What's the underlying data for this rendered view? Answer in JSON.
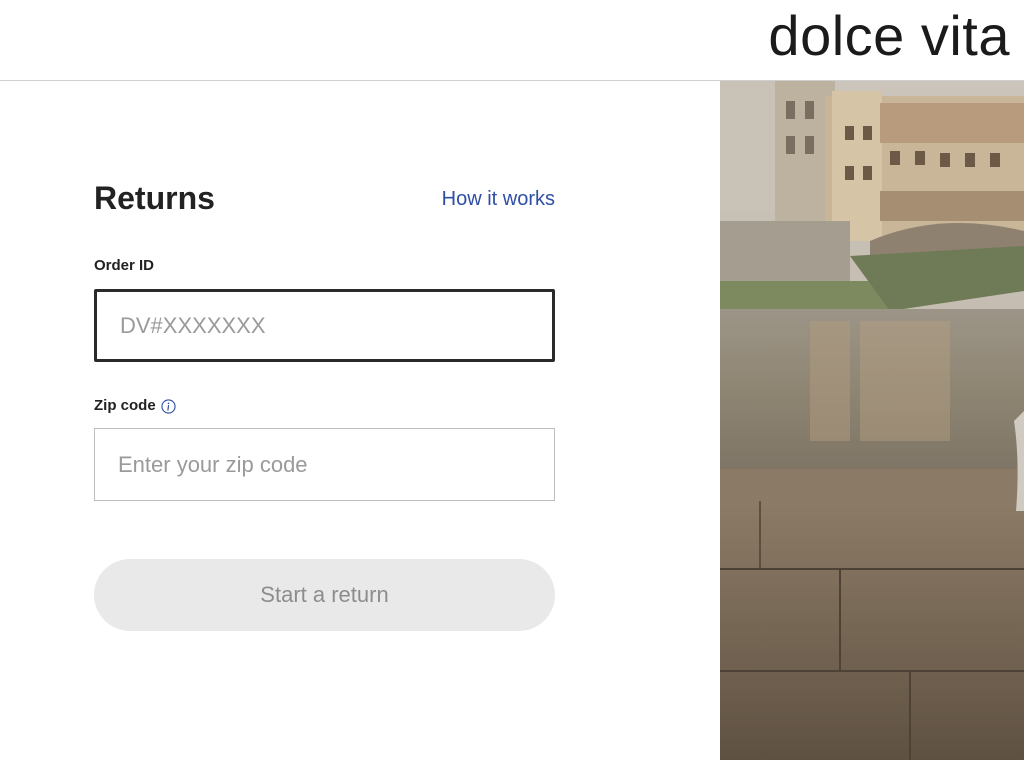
{
  "header": {
    "brand": "dolce vita"
  },
  "returns": {
    "title": "Returns",
    "how_link": "How it works",
    "order_label": "Order ID",
    "order_placeholder": "DV#XXXXXXX",
    "zip_label": "Zip code",
    "zip_placeholder": "Enter your zip code",
    "start_button": "Start a return"
  },
  "icons": {
    "info": "info-circle-icon"
  },
  "colors": {
    "link": "#2f4fa6",
    "button_bg": "#e9e9e9",
    "button_text": "#8d8d8d",
    "input_focus_border": "#2a2a2a"
  }
}
